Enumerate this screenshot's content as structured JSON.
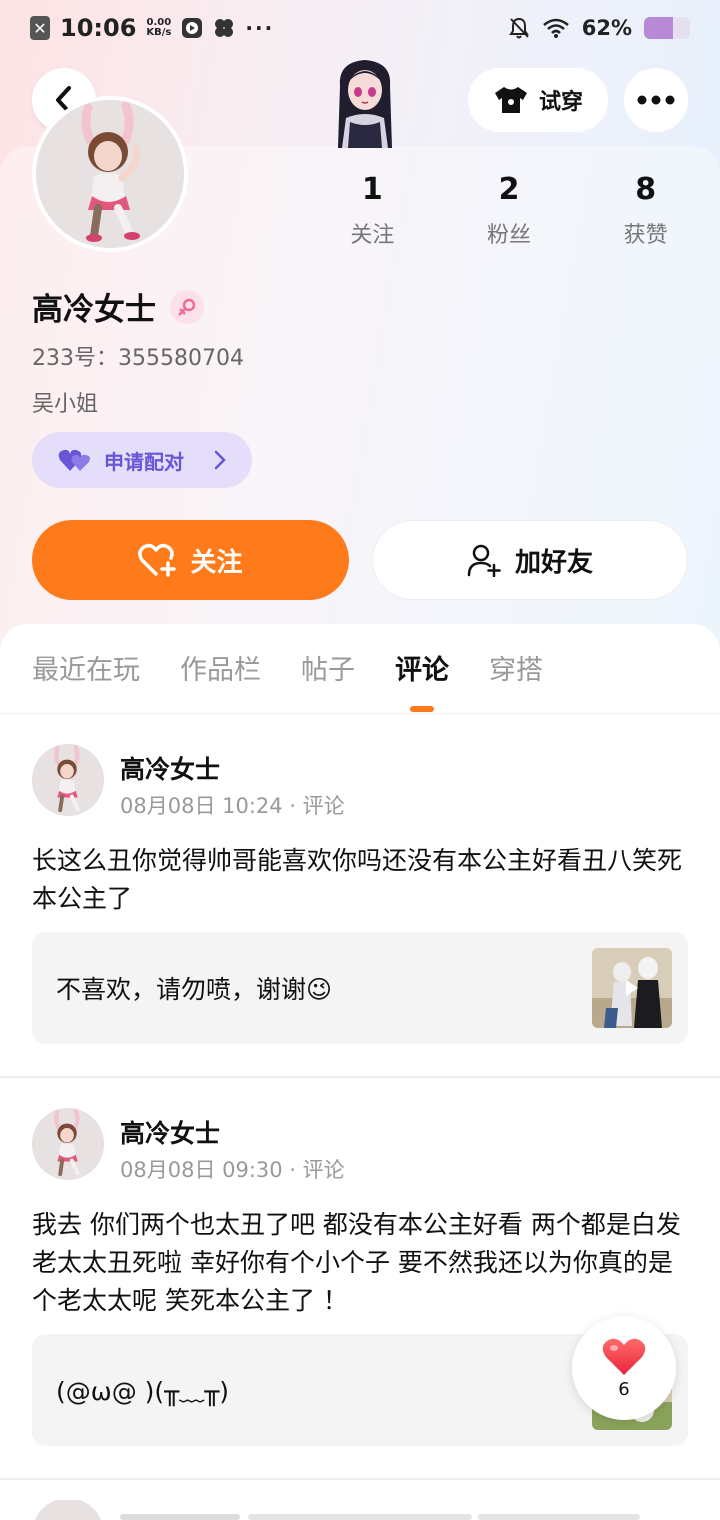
{
  "status_bar": {
    "time": "10:06",
    "speed_value": "0.00",
    "speed_unit": "KB/s",
    "dots": "···",
    "battery": "62%",
    "battery_level": 0.62
  },
  "header": {
    "back_icon": "chevron-left-icon",
    "tryon_label": "试穿",
    "more_icon": "more-dots-icon"
  },
  "stats": [
    {
      "value": "1",
      "label": "关注"
    },
    {
      "value": "2",
      "label": "粉丝"
    },
    {
      "value": "8",
      "label": "获赞"
    }
  ],
  "profile": {
    "name": "高冷女士",
    "gender_icon": "female-icon",
    "id_text": "233号：355580704",
    "note": "吴小姐",
    "pair_label": "申请配对"
  },
  "actions": {
    "follow_label": "关注",
    "add_friend_label": "加好友"
  },
  "tabs": [
    {
      "label": "最近在玩",
      "active": false
    },
    {
      "label": "作品栏",
      "active": false
    },
    {
      "label": "帖子",
      "active": false
    },
    {
      "label": "评论",
      "active": true
    },
    {
      "label": "穿搭",
      "active": false
    }
  ],
  "posts": [
    {
      "author": "高冷女士",
      "meta": "08月08日 10:24 · 评论",
      "body": "长这么丑你觉得帅哥能喜欢你吗还没有本公主好看丑八笑死本公主了",
      "reply": "不喜欢，请勿喷，谢谢😉"
    },
    {
      "author": "高冷女士",
      "meta": "08月08日 09:30 · 评论",
      "body": "我去 你们两个也太丑了吧 都没有本公主好看 两个都是白发 老太太丑死啦 幸好你有个小个子 要不然我还以为你真的是个老太太呢 笑死本公主了 ！",
      "reply": "(@ω@ )(╥﹏╥)"
    }
  ],
  "like_fab": {
    "count": "6"
  },
  "colors": {
    "accent": "#ff7a1a",
    "pair_purple": "#6a55d6",
    "pair_bg": "#e4defa"
  }
}
